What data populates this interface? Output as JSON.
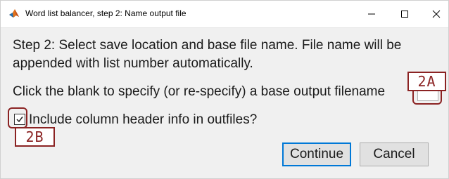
{
  "window": {
    "title": "Word list balancer, step 2: Name output file",
    "minimize_symbol": "–",
    "maximize_symbol": "☐",
    "close_symbol": "✕"
  },
  "instructions": {
    "line1": "Step 2: Select save location and base file name. File name will be",
    "line2": "appended with list number automatically.",
    "filename_prompt": "Click the blank to specify (or re-specify) a base output filename"
  },
  "filename_field": {
    "value": ""
  },
  "header_option": {
    "label": "Include column header info in outfiles?",
    "checked": true
  },
  "buttons": {
    "continue": "Continue",
    "cancel": "Cancel"
  },
  "annotations": {
    "filename_callout": "2A",
    "checkbox_callout": "2B",
    "color": "#8b2323"
  },
  "icons": {
    "app": "matlab-icon",
    "check": "checkmark-icon"
  }
}
